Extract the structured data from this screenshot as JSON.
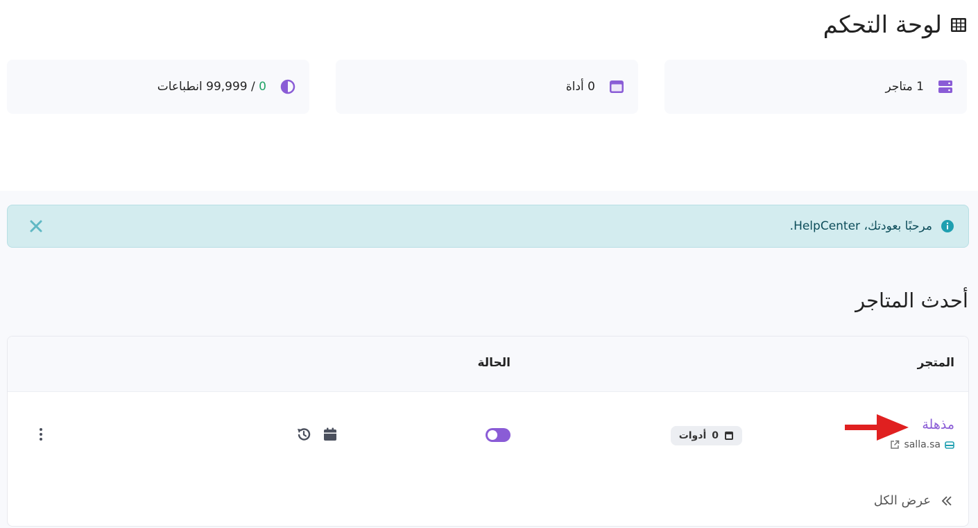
{
  "page": {
    "title": "لوحة التحكم"
  },
  "stats": {
    "stores": {
      "count": "1",
      "label": "متاجر"
    },
    "tools": {
      "count": "0",
      "label": "أداة"
    },
    "impressions": {
      "used": "0",
      "separator": " / ",
      "limit": "99,999",
      "label": "انطباعات"
    }
  },
  "alert": {
    "message": "مرحبًا بعودتك، HelpCenter."
  },
  "latest": {
    "title": "أحدث المتاجر",
    "columns": {
      "store": "المتجر",
      "status": "الحالة"
    },
    "rows": [
      {
        "name": "مذهلة",
        "domain": "salla.sa",
        "tools_count": "0",
        "tools_label": "أدوات",
        "status_on": true
      }
    ],
    "view_all": "عرض الكل"
  },
  "colors": {
    "accent": "#8a5cd6",
    "green": "#21a366",
    "alert_bg": "#d3ecef",
    "alert_icon": "#1f9fb0",
    "arrow": "#e02020"
  },
  "icons": {
    "title": "table-grid-icon",
    "stores": "server-icon",
    "tools": "window-icon",
    "impressions": "half-circle-icon",
    "alert": "info-circle-icon",
    "close": "close-icon",
    "domain": "store-icon",
    "external": "external-link-icon",
    "badge": "window-icon",
    "calendar": "calendar-icon",
    "history": "history-icon",
    "menu": "kebab-menu-icon",
    "view_all": "double-chevron-left-icon",
    "annotation": "red-arrow-icon"
  }
}
